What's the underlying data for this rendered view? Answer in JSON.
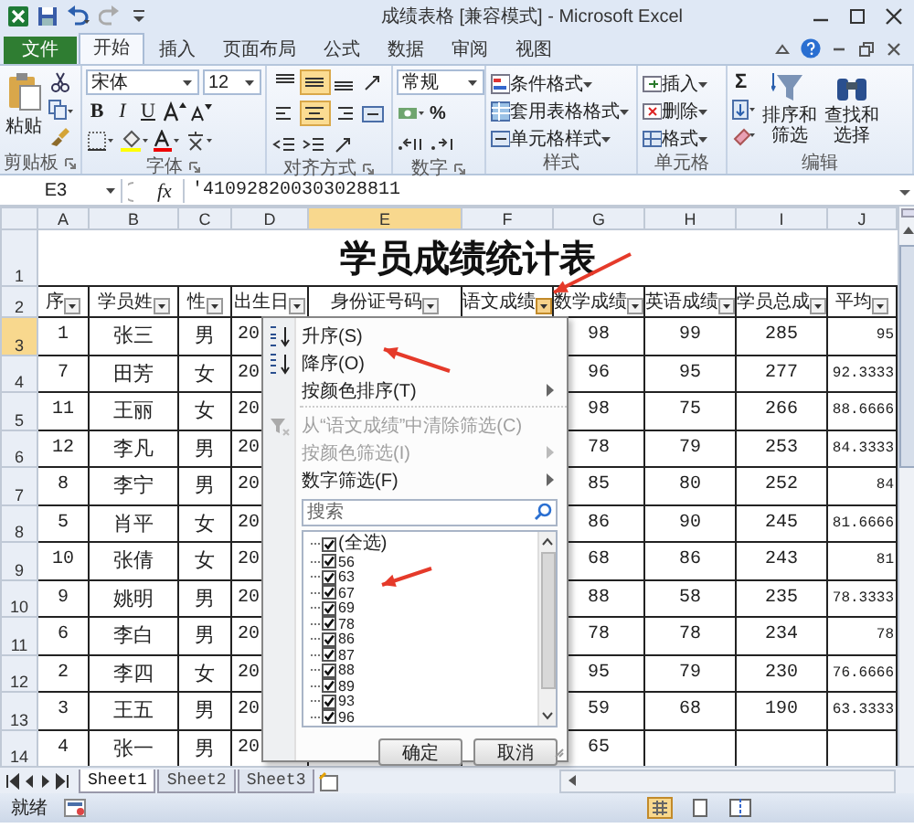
{
  "window": {
    "title": "成绩表格 [兼容模式] - Microsoft Excel"
  },
  "ribbon_tabs": [
    {
      "label": "文件",
      "kind": "file",
      "selected": false
    },
    {
      "label": "开始",
      "kind": "tab",
      "selected": true
    },
    {
      "label": "插入",
      "kind": "tab",
      "selected": false
    },
    {
      "label": "页面布局",
      "kind": "tab",
      "selected": false
    },
    {
      "label": "公式",
      "kind": "tab",
      "selected": false
    },
    {
      "label": "数据",
      "kind": "tab",
      "selected": false
    },
    {
      "label": "审阅",
      "kind": "tab",
      "selected": false
    },
    {
      "label": "视图",
      "kind": "tab",
      "selected": false
    }
  ],
  "ribbon": {
    "clipboard": {
      "paste": "粘贴",
      "label": "剪贴板"
    },
    "font": {
      "name": "宋体",
      "size": "12",
      "format_buttons": [
        "B",
        "I",
        "U"
      ],
      "label": "字体"
    },
    "alignment": {
      "buttons": [
        {
          "kind": "align-top",
          "selected": false
        },
        {
          "kind": "align-middle",
          "selected": true
        },
        {
          "kind": "align-bottom",
          "selected": false
        },
        {
          "kind": "orientation",
          "selected": false
        },
        {
          "kind": "align-left",
          "selected": false
        },
        {
          "kind": "align-center",
          "selected": true
        },
        {
          "kind": "align-right",
          "selected": false
        },
        {
          "kind": "merge",
          "selected": false
        },
        {
          "kind": "indent-decrease",
          "selected": false
        },
        {
          "kind": "indent-increase",
          "selected": false
        },
        {
          "kind": "orientation",
          "selected": false
        }
      ],
      "label": "对齐方式"
    },
    "number": {
      "format": "常规",
      "percent": "%",
      "label": "数字"
    },
    "styles": {
      "items": [
        "条件格式",
        "套用表格格式",
        "单元格样式"
      ],
      "label": "样式"
    },
    "cells": {
      "items": [
        "插入",
        "删除",
        "格式"
      ],
      "label": "单元格"
    },
    "editing": {
      "sum": "Σ",
      "items": [
        "排序和筛选",
        "查找和选择"
      ],
      "label": "编辑"
    }
  },
  "formula_bar": {
    "name_box": "E3",
    "fx": "fx",
    "value": "'410928200303028811"
  },
  "columns": [
    {
      "letter": "A",
      "selected": false
    },
    {
      "letter": "B",
      "selected": false
    },
    {
      "letter": "C",
      "selected": false
    },
    {
      "letter": "D",
      "selected": false
    },
    {
      "letter": "E",
      "selected": true
    },
    {
      "letter": "F",
      "selected": false
    },
    {
      "letter": "G",
      "selected": false
    },
    {
      "letter": "H",
      "selected": false
    },
    {
      "letter": "I",
      "selected": false
    },
    {
      "letter": "J",
      "selected": false
    }
  ],
  "title_row": {
    "number": "1",
    "title": "学员成绩统计表"
  },
  "header_row": {
    "number": "2",
    "cells": [
      {
        "label": "序",
        "filter_open": false
      },
      {
        "label": "学员姓",
        "filter_open": false
      },
      {
        "label": "性",
        "filter_open": false
      },
      {
        "label": "出生日",
        "filter_open": false
      },
      {
        "label": "身份证号码",
        "filter_open": false
      },
      {
        "label": "语文成绩",
        "filter_open": true
      },
      {
        "label": "数学成绩",
        "filter_open": false
      },
      {
        "label": "英语成绩",
        "filter_open": false
      },
      {
        "label": "学员总成",
        "filter_open": false
      },
      {
        "label": "平均",
        "filter_open": false
      }
    ]
  },
  "rows": [
    {
      "number": "3",
      "selected": true,
      "no": "1",
      "name": "张三",
      "gender": "男",
      "birth": "20",
      "math": "98",
      "english": "99",
      "total": "285",
      "average": "95"
    },
    {
      "number": "4",
      "selected": false,
      "no": "7",
      "name": "田芳",
      "gender": "女",
      "birth": "20",
      "math": "96",
      "english": "95",
      "total": "277",
      "average": "92.3333"
    },
    {
      "number": "5",
      "selected": false,
      "no": "11",
      "name": "王丽",
      "gender": "女",
      "birth": "20",
      "math": "98",
      "english": "75",
      "total": "266",
      "average": "88.6666"
    },
    {
      "number": "6",
      "selected": false,
      "no": "12",
      "name": "李凡",
      "gender": "男",
      "birth": "20",
      "math": "78",
      "english": "79",
      "total": "253",
      "average": "84.3333"
    },
    {
      "number": "7",
      "selected": false,
      "no": "8",
      "name": "李宁",
      "gender": "男",
      "birth": "20",
      "math": "85",
      "english": "80",
      "total": "252",
      "average": "84"
    },
    {
      "number": "8",
      "selected": false,
      "no": "5",
      "name": "肖平",
      "gender": "女",
      "birth": "20",
      "math": "86",
      "english": "90",
      "total": "245",
      "average": "81.6666"
    },
    {
      "number": "9",
      "selected": false,
      "no": "10",
      "name": "张倩",
      "gender": "女",
      "birth": "20",
      "math": "68",
      "english": "86",
      "total": "243",
      "average": "81"
    },
    {
      "number": "10",
      "selected": false,
      "no": "9",
      "name": "姚明",
      "gender": "男",
      "birth": "20",
      "math": "88",
      "english": "58",
      "total": "235",
      "average": "78.3333"
    },
    {
      "number": "11",
      "selected": false,
      "no": "6",
      "name": "李白",
      "gender": "男",
      "birth": "20",
      "math": "78",
      "english": "78",
      "total": "234",
      "average": "78"
    },
    {
      "number": "12",
      "selected": false,
      "no": "2",
      "name": "李四",
      "gender": "女",
      "birth": "20",
      "math": "95",
      "english": "79",
      "total": "230",
      "average": "76.6666"
    },
    {
      "number": "13",
      "selected": false,
      "no": "3",
      "name": "王五",
      "gender": "男",
      "birth": "20",
      "math": "59",
      "english": "68",
      "total": "190",
      "average": "63.3333"
    },
    {
      "number": "14",
      "selected": false,
      "no": "4",
      "name": "张一",
      "gender": "男",
      "birth": "20",
      "math": "65"
    }
  ],
  "filter_menu": {
    "items": [
      {
        "label": "升序(S)",
        "kind": "sort-ascending",
        "disabled": false
      },
      {
        "label": "降序(O)",
        "kind": "sort-descending",
        "disabled": false
      },
      {
        "label": "按颜色排序(T)",
        "kind": "submenu",
        "disabled": false
      },
      {
        "label": "从“语文成绩”中清除筛选(C)",
        "kind": "clear-filter",
        "disabled": true
      },
      {
        "label": "按颜色筛选(I)",
        "kind": "submenu",
        "disabled": true
      },
      {
        "label": "数字筛选(F)",
        "kind": "submenu",
        "disabled": false
      }
    ],
    "search": {
      "placeholder": "搜索"
    },
    "values": [
      {
        "label": "(全选)",
        "checked": true
      },
      {
        "label": "56",
        "checked": true
      },
      {
        "label": "63",
        "checked": true
      },
      {
        "label": "67",
        "checked": true
      },
      {
        "label": "69",
        "checked": true
      },
      {
        "label": "78",
        "checked": true
      },
      {
        "label": "86",
        "checked": true
      },
      {
        "label": "87",
        "checked": true
      },
      {
        "label": "88",
        "checked": true
      },
      {
        "label": "89",
        "checked": true
      },
      {
        "label": "93",
        "checked": true
      },
      {
        "label": "96",
        "checked": true
      }
    ],
    "buttons": [
      "确定",
      "取消"
    ]
  },
  "sheet_tabs": [
    {
      "label": "Sheet1",
      "selected": true
    },
    {
      "label": "Sheet2",
      "selected": false
    },
    {
      "label": "Sheet3",
      "selected": false
    }
  ],
  "status_bar": {
    "text": "就绪"
  }
}
